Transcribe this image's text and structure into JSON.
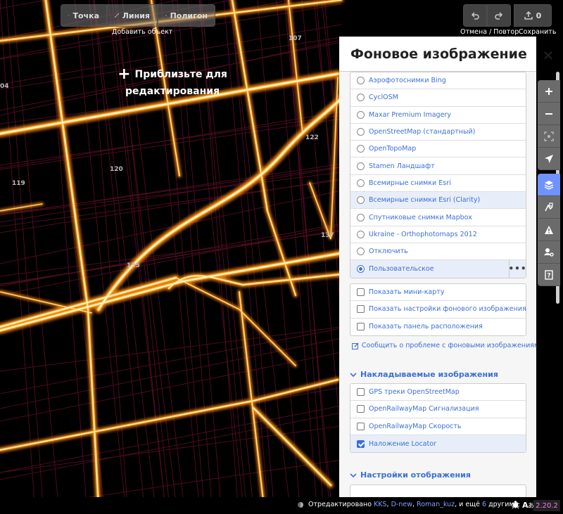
{
  "toolbar": {
    "point_label": "Точка",
    "line_label": "Линия",
    "polygon_label": "Полигон",
    "add_caption": "Добавить объект",
    "undo_caption": "Отмена / Повтор",
    "save_caption": "Сохранить",
    "save_count": "0"
  },
  "zoom_hint": {
    "line1": "Приблизьте для",
    "line2": "редактирования"
  },
  "map_labels": [
    "107",
    "122",
    "120",
    "119",
    "137",
    "135",
    "04"
  ],
  "panel": {
    "title": "Фоновое изображение",
    "close_label": "✕",
    "backgrounds": [
      {
        "label": "Аэрофотоснимки Bing"
      },
      {
        "label": "CyclOSM"
      },
      {
        "label": "Maxar Premium Imagery"
      },
      {
        "label": "OpenStreetMap (стандартный)"
      },
      {
        "label": "OpenTopoMap"
      },
      {
        "label": "Stamen Ландшафт"
      },
      {
        "label": "Всемирные снимки Esri"
      },
      {
        "label": "Всемирные снимки Esri (Clarity)"
      },
      {
        "label": "Спутниковые снимки Mapbox"
      },
      {
        "label": "Ukraine - Orthophotomaps 2012"
      },
      {
        "label": "Отключить"
      },
      {
        "label": "Пользовательское"
      }
    ],
    "custom_more": "•••",
    "options": [
      {
        "label": "Показать мини-карту"
      },
      {
        "label": "Показать настройки фонового изображения"
      },
      {
        "label": "Показать панель расположения"
      }
    ],
    "issue_link": "Сообщить о проблеме с фоновыми изображениями",
    "overlays_title": "Накладываемые изображения",
    "overlays": [
      {
        "label": "GPS треки OpenStreetMap"
      },
      {
        "label": "OpenRailwayMap Сигнализация"
      },
      {
        "label": "OpenRailwayMap Скорость"
      },
      {
        "label": "Наложение Locator"
      }
    ],
    "display_title": "Настройки отображения"
  },
  "footer": {
    "edited_prefix": "Отредактировано",
    "user1": "KKS",
    "user2": "D-new",
    "user3": "Roman_kuz",
    "suffix_a": ", и ещё",
    "others_count": "6",
    "suffix_b": "другими",
    "version": "2.20.2"
  },
  "colors": {
    "accent": "#7092ff",
    "link": "#3b6fd8",
    "heat_core": "#fff6c0",
    "heat_mid": "#ff9a1a",
    "heat_low": "#8a1a3a"
  }
}
